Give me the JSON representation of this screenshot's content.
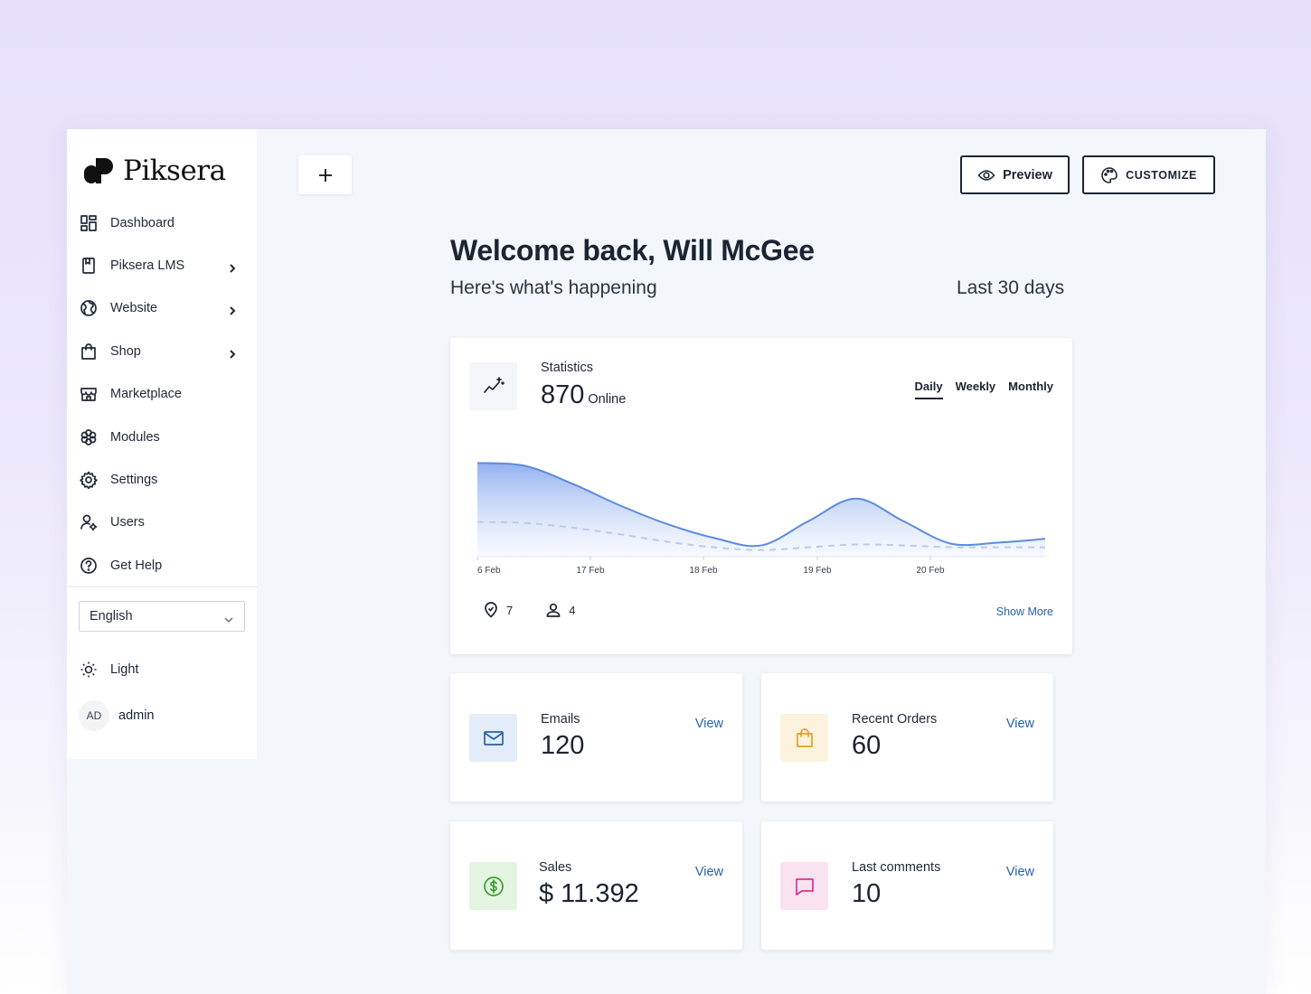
{
  "brand": {
    "name": "Piksera"
  },
  "sidebar": {
    "items": [
      {
        "label": "Dashboard",
        "icon": "dashboard-icon",
        "has_submenu": false
      },
      {
        "label": "Piksera LMS",
        "icon": "book-icon",
        "has_submenu": true
      },
      {
        "label": "Website",
        "icon": "globe-icon",
        "has_submenu": true
      },
      {
        "label": "Shop",
        "icon": "shopping-bag-icon",
        "has_submenu": true
      },
      {
        "label": "Marketplace",
        "icon": "store-icon",
        "has_submenu": false
      },
      {
        "label": "Modules",
        "icon": "modules-icon",
        "has_submenu": false
      },
      {
        "label": "Settings",
        "icon": "gear-icon",
        "has_submenu": false
      },
      {
        "label": "Users",
        "icon": "users-gear-icon",
        "has_submenu": false
      },
      {
        "label": "Get Help",
        "icon": "help-icon",
        "has_submenu": false
      }
    ],
    "language": "English",
    "theme": "Light",
    "user": {
      "initials": "AD",
      "name": "admin"
    }
  },
  "toolbar": {
    "add_icon": "plus-icon",
    "preview_label": "Preview",
    "customize_label": "CUSTOMIZE"
  },
  "header": {
    "title": "Welcome back, Will McGee",
    "subtitle": "Here's what's happening",
    "range": "Last 30 days"
  },
  "statistics": {
    "title": "Statistics",
    "value": "870",
    "unit": "Online",
    "tabs": [
      "Daily",
      "Weekly",
      "Monthly"
    ],
    "active_tab": "Daily",
    "footer": {
      "locations": "7",
      "users": "4"
    },
    "show_more": "Show More",
    "colors": {
      "primary": "#5b8be0",
      "secondary": "#b9cbef"
    }
  },
  "chart_data": {
    "type": "area",
    "x": [
      "6 Feb",
      "17 Feb",
      "18 Feb",
      "19 Feb",
      "20 Feb"
    ],
    "series": [
      {
        "values": [
          100,
          97,
          78,
          55,
          35,
          20,
          12,
          38,
          62,
          38,
          14,
          15,
          19
        ]
      },
      {
        "values": [
          37,
          36,
          31,
          24,
          16,
          10,
          7,
          10,
          13,
          12,
          10,
          10,
          10
        ]
      }
    ],
    "ylim": [
      0,
      110
    ],
    "grid": false
  },
  "cards": [
    {
      "title": "Emails",
      "value": "120",
      "action": "View",
      "icon": "mail-icon",
      "color": "#2563a8",
      "bg": "#e3ecf8"
    },
    {
      "title": "Recent Orders",
      "value": "60",
      "action": "View",
      "icon": "shopping-bag-icon",
      "color": "#e0a321",
      "bg": "#fcf2dd"
    },
    {
      "title": "Sales",
      "value": "$ 11.392",
      "action": "View",
      "icon": "dollar-circle-icon",
      "color": "#3c9a2e",
      "bg": "#e3f5e0"
    },
    {
      "title": "Last comments",
      "value": "10",
      "action": "View",
      "icon": "comment-icon",
      "color": "#d9328f",
      "bg": "#fbe2f0"
    }
  ]
}
